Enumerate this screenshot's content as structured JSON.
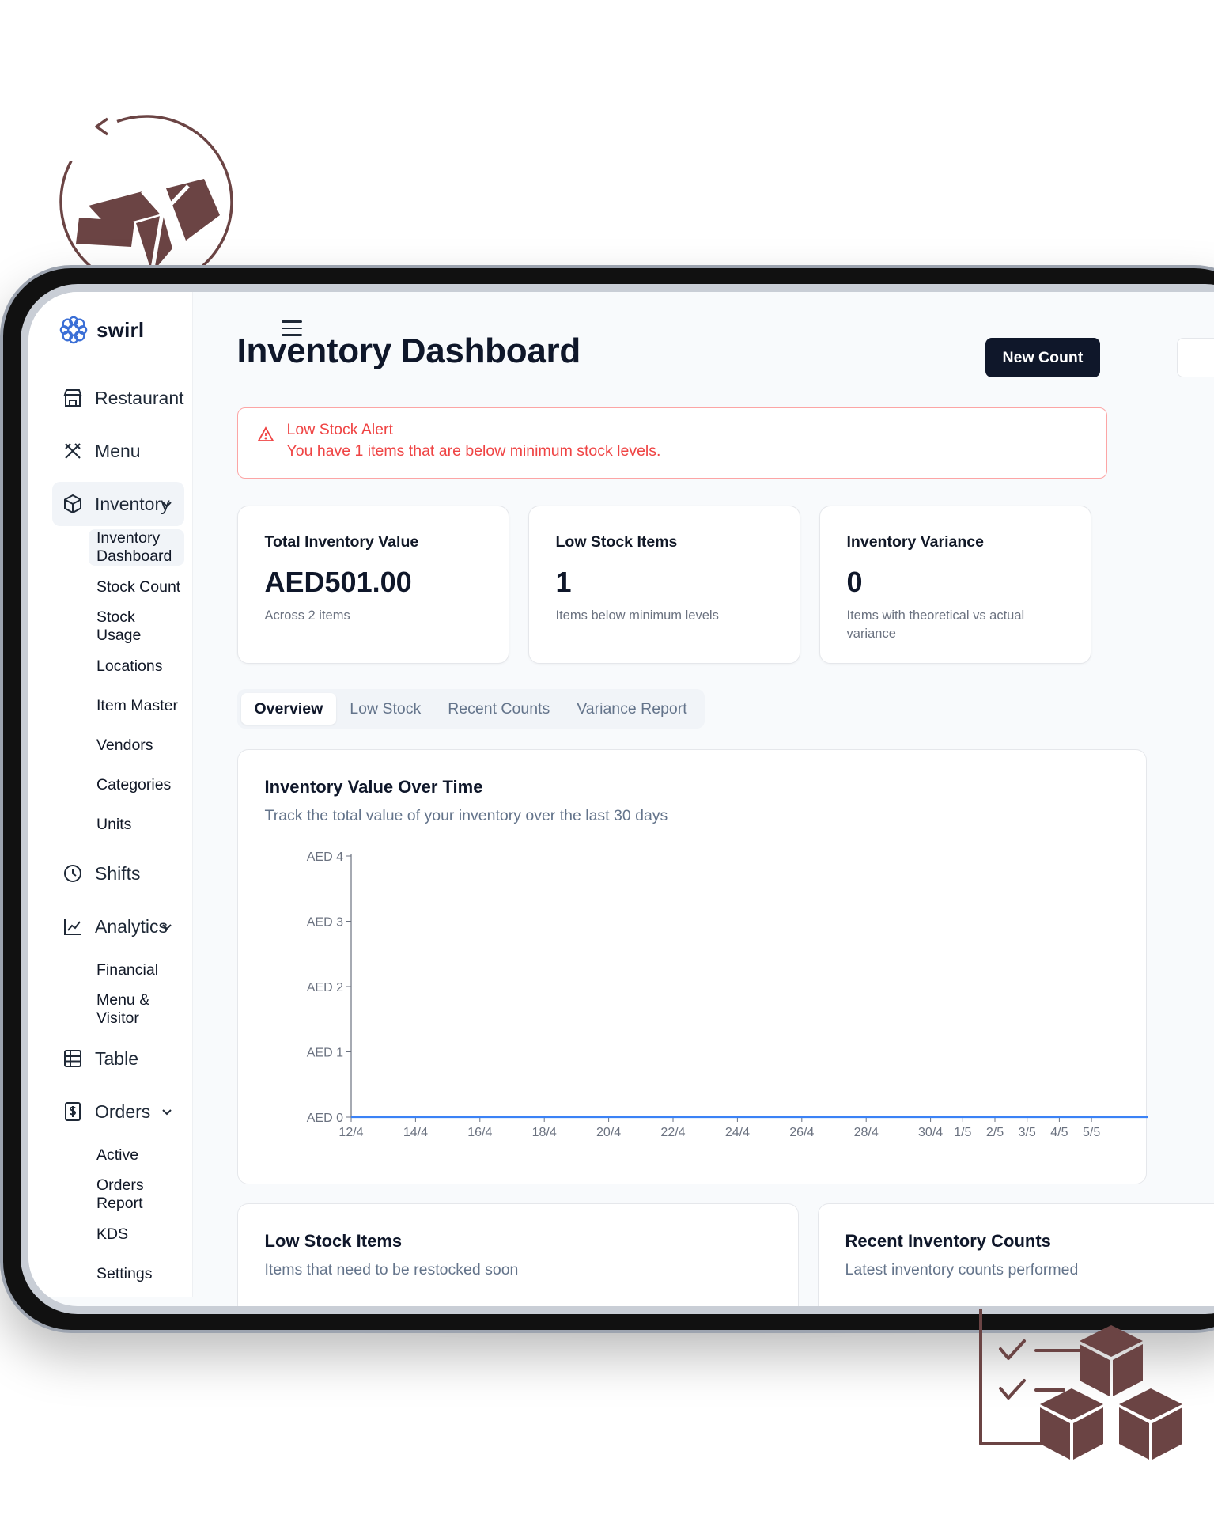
{
  "app": {
    "brand_name": "swirl"
  },
  "sidebar": {
    "items": [
      {
        "label": "Restaurant",
        "icon": "store-icon"
      },
      {
        "label": "Menu",
        "icon": "utensils-icon"
      },
      {
        "label": "Inventory",
        "icon": "package-icon",
        "expanded": true,
        "children": [
          "Inventory Dashboard",
          "Stock Count",
          "Stock Usage",
          "Locations",
          "Item Master",
          "Vendors",
          "Categories",
          "Units"
        ]
      },
      {
        "label": "Shifts",
        "icon": "clock-icon"
      },
      {
        "label": "Analytics",
        "icon": "chart-line-icon",
        "expanded": true,
        "children": [
          "Financial",
          "Menu & Visitor"
        ]
      },
      {
        "label": "Table",
        "icon": "table-icon"
      },
      {
        "label": "Orders",
        "icon": "receipt-icon",
        "expanded": true,
        "children": [
          "Active",
          "Orders Report",
          "KDS",
          "Settings"
        ]
      }
    ],
    "active_child": "Inventory Dashboard"
  },
  "header": {
    "title": "Inventory Dashboard",
    "new_count_label": "New Count"
  },
  "alert": {
    "title": "Low Stock Alert",
    "text": "You have 1 items that are below minimum stock levels."
  },
  "stats": [
    {
      "label": "Total Inventory Value",
      "value": "AED501.00",
      "sub": "Across 2 items"
    },
    {
      "label": "Low Stock Items",
      "value": "1",
      "sub": "Items below minimum levels"
    },
    {
      "label": "Inventory Variance",
      "value": "0",
      "sub": "Items with theoretical vs actual variance"
    }
  ],
  "tabs": [
    "Overview",
    "Low Stock",
    "Recent Counts",
    "Variance Report"
  ],
  "active_tab": "Overview",
  "chart_card": {
    "title": "Inventory Value Over Time",
    "subtitle": "Track the total value of your inventory over the last 30 days"
  },
  "chart_data": {
    "type": "line",
    "x": [
      "12/4",
      "14/4",
      "16/4",
      "18/4",
      "20/4",
      "22/4",
      "24/4",
      "26/4",
      "28/4",
      "30/4",
      "1/5",
      "2/5",
      "3/5",
      "4/5",
      "5/5"
    ],
    "series": [
      {
        "values": [
          0,
          0,
          0,
          0,
          0,
          0,
          0,
          0,
          0,
          0,
          0,
          0,
          0,
          0,
          0
        ]
      }
    ],
    "y_ticks": [
      "AED 0",
      "AED 1",
      "AED 2",
      "AED 3",
      "AED 4"
    ],
    "ylim": [
      0,
      4
    ],
    "line_color": "#3b82f6"
  },
  "bottom_cards": [
    {
      "title": "Low Stock Items",
      "sub": "Items that need to be restocked soon"
    },
    {
      "title": "Recent Inventory Counts",
      "sub": "Latest inventory counts performed"
    }
  ],
  "colors": {
    "accent_dark": "#0f172a",
    "alert_red": "#ef4444",
    "deco_brown": "#6b4040"
  }
}
